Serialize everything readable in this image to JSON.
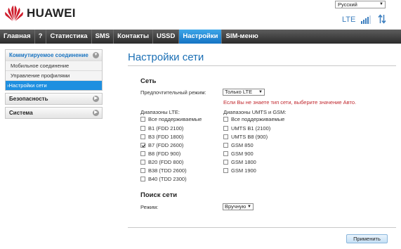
{
  "header": {
    "brand": "HUAWEI",
    "brand_color": "#cf1f2e",
    "language": "Русский",
    "network_type": "LTE",
    "signal_level": 4,
    "icons": [
      "huawei-logo",
      "signal-bars-icon",
      "transfer-arrows-icon",
      "chevron-down-icon"
    ]
  },
  "nav": {
    "items": [
      {
        "label": "Главная",
        "active": false
      },
      {
        "label": "?",
        "active": false
      },
      {
        "label": "Статистика",
        "active": false
      },
      {
        "label": "SMS",
        "active": false
      },
      {
        "label": "Контакты",
        "active": false
      },
      {
        "label": "USSD",
        "active": false
      },
      {
        "label": "Настройки",
        "active": true
      },
      {
        "label": "SIM-меню",
        "active": false
      }
    ],
    "accent_color": "#1e8fe0"
  },
  "sidebar": {
    "groups": [
      {
        "label": "Коммутируемое соединение",
        "expanded": true,
        "items": [
          {
            "label": "Мобильное соединение",
            "active": false
          },
          {
            "label": "Управление профилями",
            "active": false
          },
          {
            "label": "›Настройки сети",
            "active": true
          }
        ]
      },
      {
        "label": "Безопасность",
        "expanded": false,
        "items": []
      },
      {
        "label": "Система",
        "expanded": false,
        "items": []
      }
    ]
  },
  "main": {
    "title": "Настройки сети",
    "network_section": {
      "title": "Сеть",
      "preferred_mode_label": "Предпочтительный режим:",
      "preferred_mode_value": "Только LTE",
      "warning": "Если Вы не знаете тип сети, выберите значение Авто.",
      "lte_bands_label": "Диапазоны LTE:",
      "lte_bands": [
        {
          "label": "Все поддерживаемые",
          "checked": false
        },
        {
          "label": "B1 (FDD 2100)",
          "checked": false
        },
        {
          "label": "B3 (FDD 1800)",
          "checked": false
        },
        {
          "label": "B7 (FDD 2600)",
          "checked": true
        },
        {
          "label": "B8 (FDD 900)",
          "checked": false
        },
        {
          "label": "B20 (FDD 800)",
          "checked": false
        },
        {
          "label": "B38 (TDD 2600)",
          "checked": false
        },
        {
          "label": "B40 (TDD 2300)",
          "checked": false
        }
      ],
      "umts_gsm_label": "Диапазоны UMTS и GSM:",
      "umts_gsm_bands": [
        {
          "label": "Все поддерживаемые",
          "checked": false
        },
        {
          "label": "UMTS B1 (2100)",
          "checked": false
        },
        {
          "label": "UMTS B8 (900)",
          "checked": false
        },
        {
          "label": "GSM 850",
          "checked": false
        },
        {
          "label": "GSM 900",
          "checked": false
        },
        {
          "label": "GSM 1800",
          "checked": false
        },
        {
          "label": "GSM 1900",
          "checked": false
        }
      ]
    },
    "search_section": {
      "title": "Поиск сети",
      "mode_label": "Режим:",
      "mode_value": "Вручную"
    },
    "apply_label": "Применить"
  }
}
